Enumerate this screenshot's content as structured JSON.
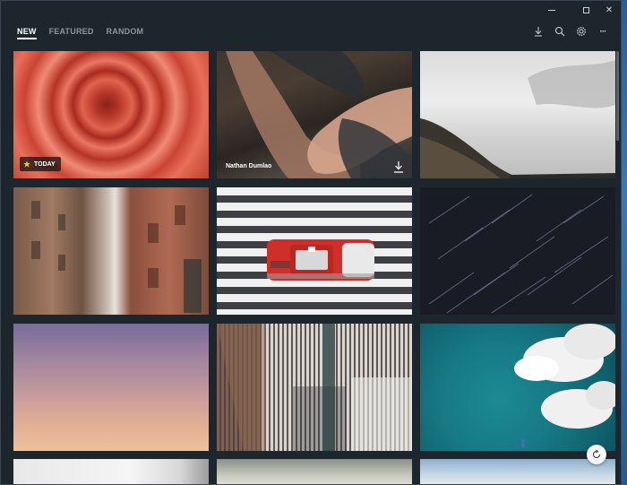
{
  "window": {
    "controls": {
      "close_glyph": "✕"
    }
  },
  "nav": {
    "tabs": [
      {
        "label": "NEW",
        "active": true
      },
      {
        "label": "FEATURED",
        "active": false
      },
      {
        "label": "RANDOM",
        "active": false
      }
    ]
  },
  "toolbar": {
    "icons": [
      "download-icon",
      "search-icon",
      "settings-icon",
      "more-icon"
    ],
    "more_glyph": "···"
  },
  "gallery": {
    "featured_tile": {
      "badge_label": "TODAY",
      "badge_icon": "star-icon",
      "star_color": "#f2c230"
    },
    "hover_tile": {
      "author": "Nathan Dumlao",
      "action_icon": "download-icon"
    },
    "tiles": [
      {
        "subject": "rose"
      },
      {
        "subject": "hands"
      },
      {
        "subject": "hill-sky"
      },
      {
        "subject": "alley-buildings"
      },
      {
        "subject": "taxi-crosswalk"
      },
      {
        "subject": "star-trails"
      },
      {
        "subject": "sunset-sky"
      },
      {
        "subject": "building-facade"
      },
      {
        "subject": "ocean-clouds"
      },
      {
        "subject": "bottom-1"
      },
      {
        "subject": "bottom-2"
      },
      {
        "subject": "bottom-3"
      }
    ]
  },
  "refresh": {
    "icon": "refresh-icon"
  }
}
